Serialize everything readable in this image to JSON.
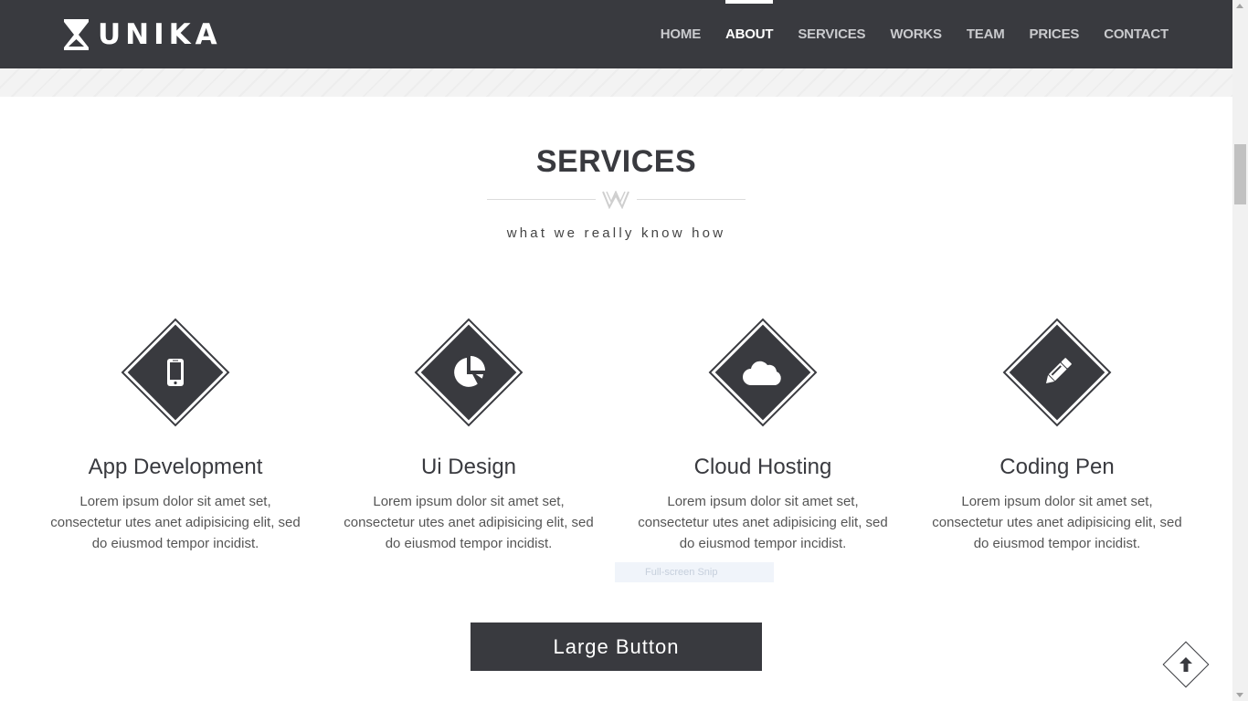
{
  "header": {
    "logo_text": "UNIKA",
    "nav": [
      "HOME",
      "ABOUT",
      "SERVICES",
      "WORKS",
      "TEAM",
      "PRICES",
      "CONTACT"
    ],
    "active": "ABOUT"
  },
  "section": {
    "title": "SERVICES",
    "subtitle": "what we really know how"
  },
  "services": [
    {
      "icon": "mobile-icon",
      "title": "App Development",
      "text": "Lorem ipsum dolor sit amet set, consectetur utes anet adipisicing elit, sed do eiusmod tempor incidist."
    },
    {
      "icon": "pie-chart-icon",
      "title": "Ui Design",
      "text": "Lorem ipsum dolor sit amet set, consectetur utes anet adipisicing elit, sed do eiusmod tempor incidist."
    },
    {
      "icon": "cloud-icon",
      "title": "Cloud Hosting",
      "text": "Lorem ipsum dolor sit amet set, consectetur utes anet adipisicing elit, sed do eiusmod tempor incidist."
    },
    {
      "icon": "pencil-icon",
      "title": "Coding Pen",
      "text": "Lorem ipsum dolor sit amet set, consectetur utes anet adipisicing elit, sed do eiusmod tempor incidist."
    }
  ],
  "snip_label": "Full-screen Snip",
  "button": {
    "label": "Large Button"
  },
  "colors": {
    "primary": "#393a3f",
    "background": "#ffffff",
    "nav_text": "#c9cacd"
  }
}
